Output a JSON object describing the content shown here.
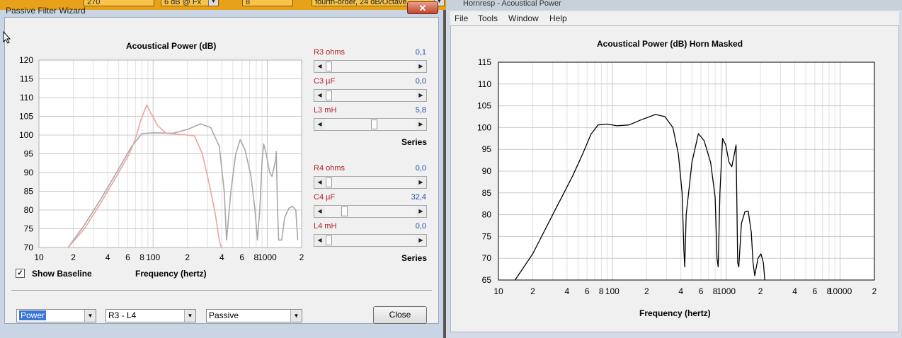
{
  "background_app": {
    "fields": [
      "270",
      "6 dB @ Fx",
      "8",
      "fourth-order, 24 dB/Octave"
    ],
    "right_title": "Hornresp - Acoustical Power"
  },
  "wizard": {
    "title": "Passive Filter Wizard",
    "close_glyph": "✕",
    "chart_title": "Acoustical Power (dB)",
    "show_baseline_label": "Show Baseline",
    "show_baseline_checked": true,
    "check_glyph": "✓",
    "xlabel": "Frequency (hertz)",
    "controls_top": [
      {
        "label": "R3  ohms",
        "value": "0,1",
        "position": 0.0
      },
      {
        "label": "C3  µF",
        "value": "0,0",
        "position": 0.0
      },
      {
        "label": "L3  mH",
        "value": "5,8",
        "position": 0.55
      }
    ],
    "series_top": "Series",
    "controls_bottom": [
      {
        "label": "R4  ohms",
        "value": "0,0",
        "position": 0.0
      },
      {
        "label": "C4  µF",
        "value": "32,4",
        "position": 0.19
      },
      {
        "label": "L4  mH",
        "value": "0,0",
        "position": 0.0
      }
    ],
    "series_bottom": "Series",
    "combo_power": "Power",
    "combo_range": "R3 - L4",
    "combo_mode": "Passive",
    "close_button": "Close",
    "arrow_left": "◀",
    "arrow_right": "▶",
    "arrow_down": "▼"
  },
  "hornresp": {
    "menu": [
      "File",
      "Tools",
      "Window",
      "Help"
    ],
    "chart_title": "Acoustical Power (dB)    Horn    Masked",
    "xlabel": "Frequency (hertz)"
  },
  "chart_data": [
    {
      "type": "line",
      "title": "Acoustical Power (dB)",
      "xlabel": "Frequency (hertz)",
      "ylabel": "",
      "xscale": "log",
      "xlim": [
        10,
        2000
      ],
      "ylim": [
        70,
        120
      ],
      "yticks": [
        70,
        75,
        80,
        85,
        90,
        95,
        100,
        105,
        110,
        115,
        120
      ],
      "xtick_labels": [
        "10",
        "2",
        "4",
        "6",
        "8",
        "100",
        "2",
        "4",
        "6",
        "8",
        "1000",
        "2"
      ],
      "xtick_values": [
        10,
        20,
        40,
        60,
        80,
        100,
        200,
        400,
        600,
        800,
        1000,
        2000
      ],
      "grid": true,
      "series": [
        {
          "color": "#a8a8a8",
          "points": [
            [
              18,
              70
            ],
            [
              25,
              76
            ],
            [
              35,
              83
            ],
            [
              50,
              91
            ],
            [
              65,
              97
            ],
            [
              80,
              100.4
            ],
            [
              100,
              100.6
            ],
            [
              150,
              100.5
            ],
            [
              200,
              101.5
            ],
            [
              260,
              103
            ],
            [
              320,
              102
            ],
            [
              380,
              97
            ],
            [
              420,
              85
            ],
            [
              440,
              72
            ],
            [
              480,
              85
            ],
            [
              530,
              95
            ],
            [
              580,
              98.8
            ],
            [
              640,
              96
            ],
            [
              720,
              89
            ],
            [
              780,
              80
            ],
            [
              820,
              72
            ],
            [
              860,
              80
            ],
            [
              900,
              93
            ],
            [
              930,
              97.6
            ],
            [
              980,
              95
            ],
            [
              1050,
              90
            ],
            [
              1100,
              89
            ],
            [
              1180,
              93
            ],
            [
              1200,
              95.6
            ],
            [
              1230,
              80
            ],
            [
              1260,
              72
            ],
            [
              1340,
              72
            ],
            [
              1420,
              78
            ],
            [
              1550,
              80.5
            ],
            [
              1660,
              81
            ],
            [
              1780,
              80
            ],
            [
              1850,
              72
            ]
          ]
        },
        {
          "color": "#f0a0a0",
          "points": [
            [
              18,
              70
            ],
            [
              25,
              75
            ],
            [
              35,
              82
            ],
            [
              50,
              90
            ],
            [
              62,
              95
            ],
            [
              70,
              99
            ],
            [
              78,
              104
            ],
            [
              88,
              108
            ],
            [
              95,
              106
            ],
            [
              110,
              102.5
            ],
            [
              130,
              100.5
            ],
            [
              170,
              100.2
            ],
            [
              230,
              99.8
            ],
            [
              270,
              95
            ],
            [
              310,
              87
            ],
            [
              350,
              79
            ],
            [
              380,
              72
            ],
            [
              395,
              70
            ]
          ]
        }
      ]
    },
    {
      "type": "line",
      "title": "Acoustical Power (dB)    Horn    Masked",
      "xlabel": "Frequency (hertz)",
      "ylabel": "",
      "xscale": "log",
      "xlim": [
        10,
        20000
      ],
      "ylim": [
        65,
        115
      ],
      "yticks": [
        65,
        70,
        75,
        80,
        85,
        90,
        95,
        100,
        105,
        110,
        115
      ],
      "xtick_labels": [
        "10",
        "2",
        "4",
        "6",
        "8",
        "100",
        "2",
        "4",
        "6",
        "8",
        "1000",
        "2",
        "4",
        "6",
        "8",
        "10000",
        "2"
      ],
      "xtick_values": [
        10,
        20,
        40,
        60,
        80,
        100,
        200,
        400,
        600,
        800,
        1000,
        2000,
        4000,
        6000,
        8000,
        10000,
        20000
      ],
      "grid": true,
      "series": [
        {
          "color": "#000000",
          "points": [
            [
              14,
              65
            ],
            [
              20,
              71
            ],
            [
              30,
              80
            ],
            [
              45,
              89
            ],
            [
              55,
              94
            ],
            [
              65,
              98.5
            ],
            [
              75,
              100.6
            ],
            [
              90,
              100.8
            ],
            [
              110,
              100.4
            ],
            [
              140,
              100.6
            ],
            [
              180,
              101.8
            ],
            [
              240,
              103
            ],
            [
              290,
              102.5
            ],
            [
              340,
              100
            ],
            [
              380,
              94
            ],
            [
              410,
              85
            ],
            [
              425,
              72
            ],
            [
              432,
              68
            ],
            [
              445,
              80
            ],
            [
              500,
              92
            ],
            [
              570,
              98.6
            ],
            [
              640,
              97
            ],
            [
              730,
              92
            ],
            [
              800,
              84
            ],
            [
              830,
              70
            ],
            [
              850,
              68
            ],
            [
              880,
              85
            ],
            [
              930,
              97.5
            ],
            [
              990,
              96
            ],
            [
              1060,
              92
            ],
            [
              1120,
              91
            ],
            [
              1180,
              94
            ],
            [
              1220,
              96
            ],
            [
              1245,
              80
            ],
            [
              1260,
              69
            ],
            [
              1290,
              68
            ],
            [
              1360,
              78
            ],
            [
              1460,
              80.7
            ],
            [
              1560,
              80.8
            ],
            [
              1660,
              76
            ],
            [
              1720,
              69
            ],
            [
              1780,
              66
            ],
            [
              1900,
              70
            ],
            [
              2020,
              71
            ],
            [
              2120,
              69
            ],
            [
              2180,
              65
            ]
          ]
        }
      ]
    }
  ]
}
